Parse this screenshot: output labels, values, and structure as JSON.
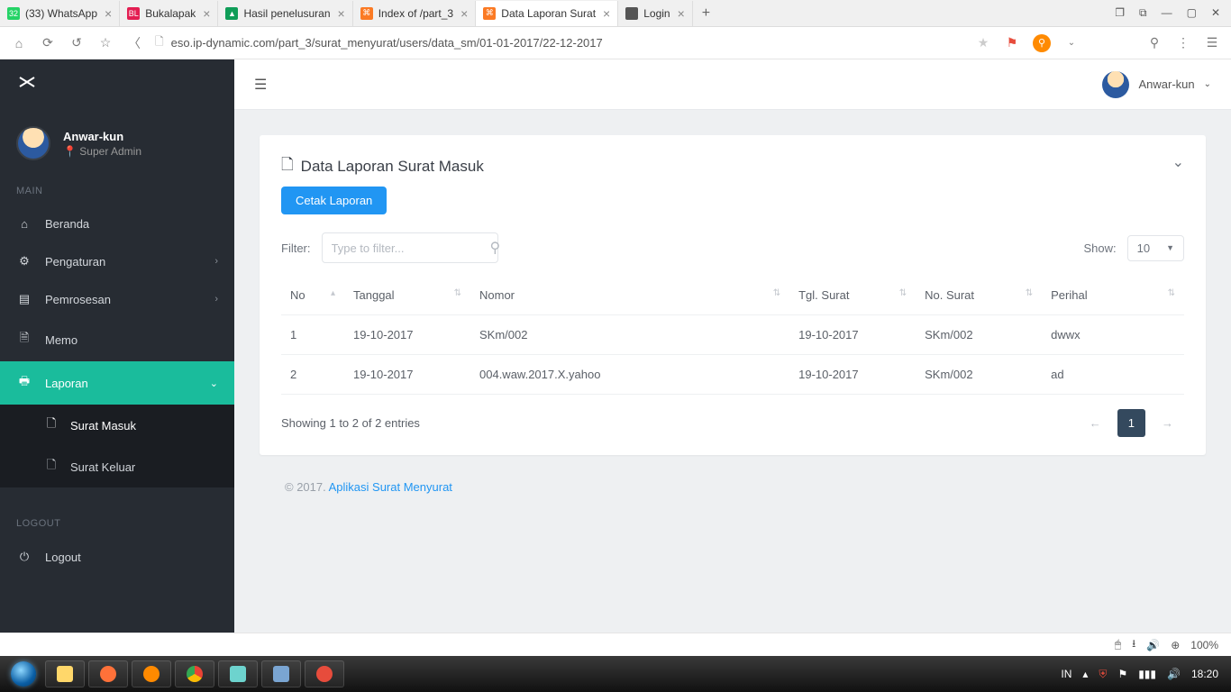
{
  "browser": {
    "tabs": [
      {
        "title": "(33) WhatsApp",
        "icon_bg": "#25d366",
        "icon_text": "32",
        "active": false
      },
      {
        "title": "Bukalapak",
        "icon_bg": "#e31e52",
        "icon_text": "BL",
        "active": false
      },
      {
        "title": "Hasil penelusuran",
        "icon_bg": "#0f9d58",
        "icon_text": "▲",
        "active": false
      },
      {
        "title": "Index of /part_3",
        "icon_bg": "#fb7a24",
        "icon_text": "⌘",
        "active": false
      },
      {
        "title": "Data Laporan Surat",
        "icon_bg": "#fb7a24",
        "icon_text": "⌘",
        "active": true
      },
      {
        "title": "Login",
        "icon_bg": "#555",
        "icon_text": "",
        "active": false
      }
    ],
    "url": "eso.ip-dynamic.com/part_3/surat_menyurat/users/data_sm/01-01-2017/22-12-2017"
  },
  "sidebar": {
    "profile": {
      "name": "Anwar-kun",
      "role": "Super Admin",
      "role_icon": "📍"
    },
    "section_main": "MAIN",
    "items": [
      {
        "label": "Beranda",
        "icon": "⌂",
        "chev": false
      },
      {
        "label": "Pengaturan",
        "icon": "⚙",
        "chev": true
      },
      {
        "label": "Pemrosesan",
        "icon": "▤",
        "chev": true
      },
      {
        "label": "Memo",
        "icon": "🗎",
        "chev": false
      },
      {
        "label": "Laporan",
        "icon": "🖶",
        "chev": true,
        "active": true
      }
    ],
    "sub": [
      {
        "label": "Surat Masuk",
        "sel": true
      },
      {
        "label": "Surat Keluar",
        "sel": false
      }
    ],
    "section_logout": "LOGOUT",
    "logout": {
      "label": "Logout",
      "icon": "⏻"
    }
  },
  "topbar": {
    "user": "Anwar-kun"
  },
  "panel": {
    "title": "Data Laporan Surat Masuk",
    "button": "Cetak Laporan",
    "filter_label": "Filter:",
    "filter_placeholder": "Type to filter...",
    "show_label": "Show:",
    "show_value": "10",
    "columns": [
      "No",
      "Tanggal",
      "Nomor",
      "Tgl. Surat",
      "No. Surat",
      "Perihal"
    ],
    "rows": [
      {
        "no": "1",
        "tanggal": "19-10-2017",
        "nomor": "SKm/002",
        "tgl_surat": "19-10-2017",
        "no_surat": "SKm/002",
        "perihal": "dwwx"
      },
      {
        "no": "2",
        "tanggal": "19-10-2017",
        "nomor": "004.waw.2017.X.yahoo",
        "tgl_surat": "19-10-2017",
        "no_surat": "SKm/002",
        "perihal": "ad"
      }
    ],
    "info": "Showing 1 to 2 of 2 entries",
    "page": "1"
  },
  "footer": {
    "copyright": "© 2017. ",
    "link": "Aplikasi Surat Menyurat"
  },
  "os": {
    "zoom": "100%",
    "lang": "IN",
    "time": "18:20"
  }
}
